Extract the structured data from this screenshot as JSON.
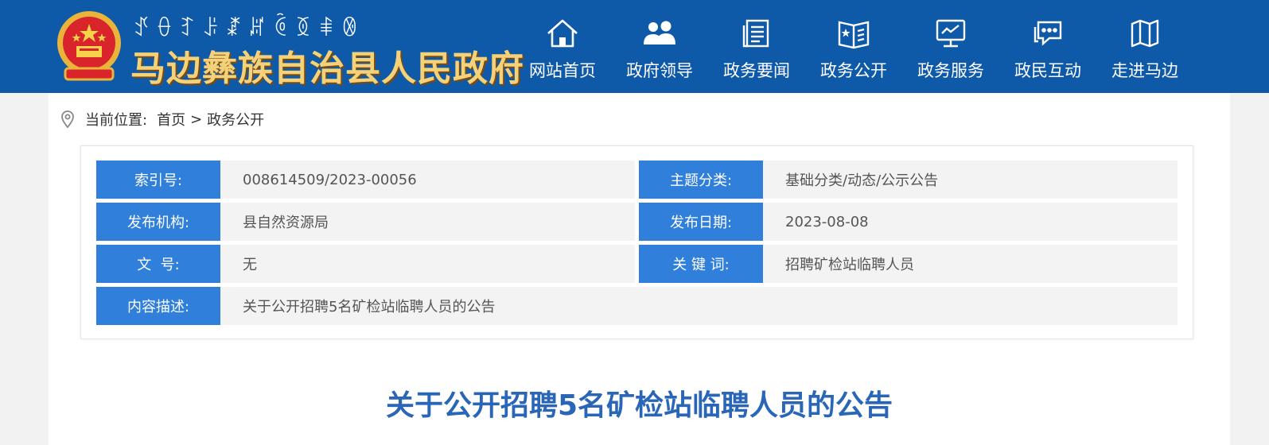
{
  "header": {
    "yi_script": "ꀋꂷꆈꌠꊨꏦꏱꅉꑌꂳ",
    "site_name": "马边彝族自治县人民政府",
    "colors": {
      "bar": "#0f5aa8",
      "title_gold": "#f4d27a"
    }
  },
  "nav": [
    {
      "label": "网站首页",
      "icon": "home-icon"
    },
    {
      "label": "政府领导",
      "icon": "people-icon"
    },
    {
      "label": "政务要闻",
      "icon": "news-icon"
    },
    {
      "label": "政务公开",
      "icon": "open-book-icon"
    },
    {
      "label": "政务服务",
      "icon": "monitor-icon"
    },
    {
      "label": "政民互动",
      "icon": "chat-icon"
    },
    {
      "label": "走进马边",
      "icon": "map-icon"
    }
  ],
  "breadcrumb": {
    "prefix": "当前位置:",
    "home": "首页",
    "separator": ">",
    "current": "政务公开"
  },
  "meta": {
    "index_no": {
      "label": "索引号:",
      "value": "008614509/2023-00056"
    },
    "category": {
      "label": "主题分类:",
      "value": "基础分类/动态/公示公告"
    },
    "publisher": {
      "label": "发布机构:",
      "value": "县自然资源局"
    },
    "publish_date": {
      "label": "发布日期:",
      "value": "2023-08-08"
    },
    "doc_no": {
      "label": "文  号:",
      "value": "无"
    },
    "keywords": {
      "label": "关 键 词:",
      "value": "招聘矿检站临聘人员"
    },
    "description": {
      "label": "内容描述:",
      "value": "关于公开招聘5名矿检站临聘人员的公告"
    },
    "colors": {
      "key_bg": "#2f7fdb",
      "value_bg": "#f3f3f3"
    }
  },
  "article": {
    "title": "关于公开招聘5名矿检站临聘人员的公告",
    "title_color": "#2a66b8"
  }
}
